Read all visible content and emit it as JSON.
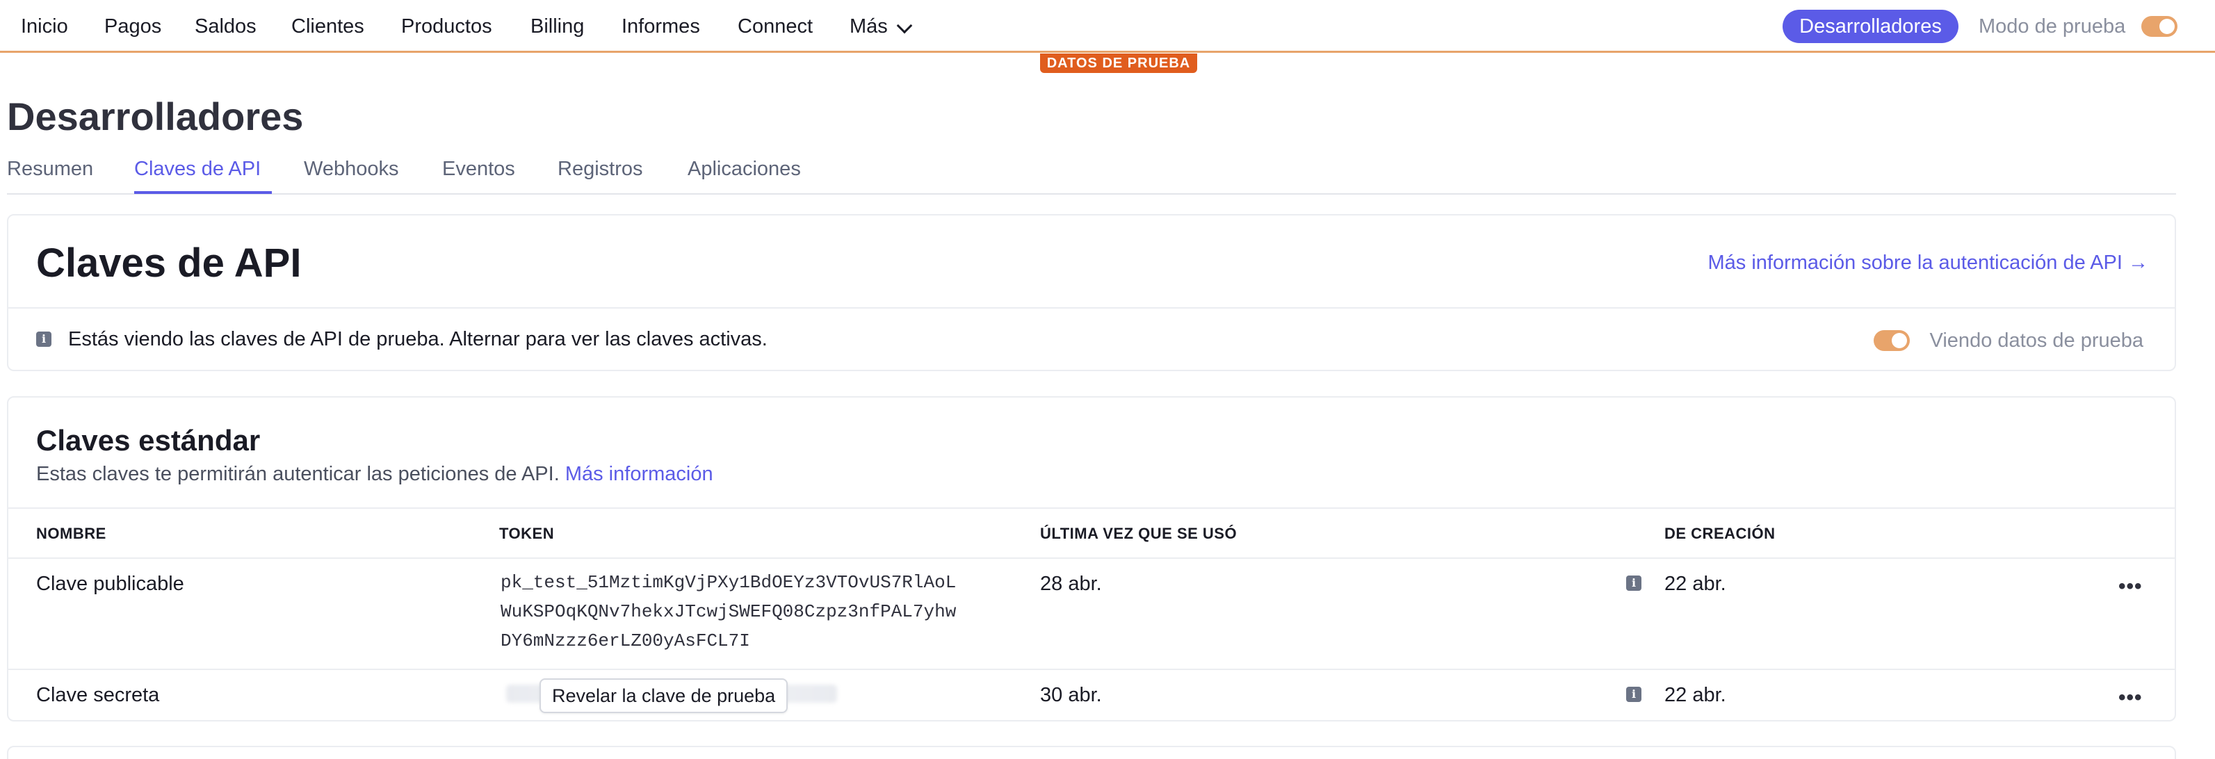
{
  "nav": {
    "items": [
      "Inicio",
      "Pagos",
      "Saldos",
      "Clientes",
      "Productos",
      "Billing",
      "Informes",
      "Connect",
      "Más"
    ],
    "developers_label": "Desarrolladores",
    "test_mode_label": "Modo de prueba",
    "test_data_badge": "DATOS DE PRUEBA",
    "accent_color": "#5b5be7",
    "test_color": "#e8a46b"
  },
  "page": {
    "title": "Desarrolladores",
    "tabs": [
      "Resumen",
      "Claves de API",
      "Webhooks",
      "Eventos",
      "Registros",
      "Aplicaciones"
    ],
    "active_tab": "Claves de API"
  },
  "api_card": {
    "title": "Claves de API",
    "doc_link": "Más información sobre la autenticación de API →",
    "notice": "Estás viendo las claves de API de prueba. Alternar para ver las claves activas.",
    "viewing_label": "Viendo datos de prueba"
  },
  "standard_keys": {
    "title": "Claves estándar",
    "description": "Estas claves te permitirán autenticar las peticiones de API.",
    "more_link": "Más información",
    "columns": [
      "NOMBRE",
      "TOKEN",
      "ÚLTIMA VEZ QUE SE USÓ",
      "DE CREACIÓN"
    ],
    "rows": [
      {
        "name": "Clave publicable",
        "token_lines": [
          "pk_test_51MztimKgVjPXy1BdOEYz3VTOvUS7RlAoL",
          "WuKSPOqKQNv7hekxJTcwjSWEFQ08Czpz3nfPAL7yhw",
          "DY6mNzzz6erLZ00yAsFCL7I"
        ],
        "last_used": "28 abr.",
        "created": "22 abr."
      },
      {
        "name": "Clave secreta",
        "reveal_label": "Revelar la clave de prueba",
        "last_used": "30 abr.",
        "created": "22 abr."
      }
    ]
  }
}
